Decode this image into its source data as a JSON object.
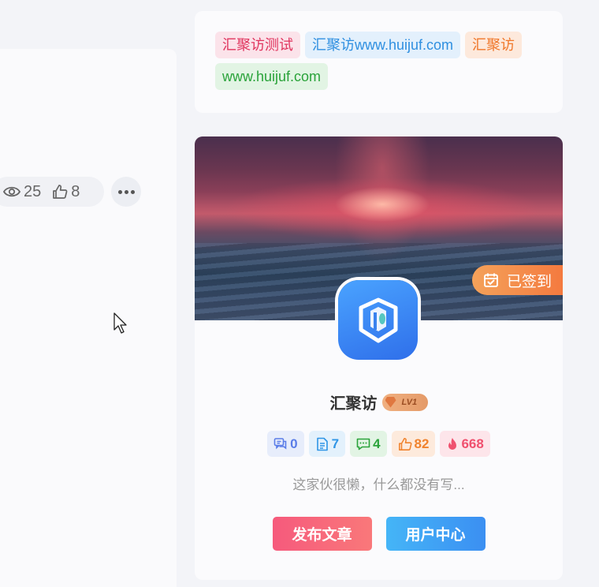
{
  "post_meta": {
    "views": "25",
    "likes": "8"
  },
  "tags": [
    {
      "label": "汇聚访测试",
      "color": "#e0355e",
      "bg": "#fbe3ea"
    },
    {
      "label": "汇聚访www.huijuf.com",
      "color": "#2f8fe0",
      "bg": "#e3f0fc"
    },
    {
      "label": "汇聚访",
      "color": "#f0772a",
      "bg": "#fde9dc"
    },
    {
      "label": "www.huijuf.com",
      "color": "#2aa33a",
      "bg": "#e2f4e4"
    }
  ],
  "user_card": {
    "checkin_label": "已签到",
    "username": "汇聚访",
    "level": "LV1",
    "stats": [
      {
        "icon": "comments-icon",
        "value": "0",
        "color": "#5a7de8",
        "bg": "#e7edfb"
      },
      {
        "icon": "document-icon",
        "value": "7",
        "color": "#2f95e6",
        "bg": "#e3f1fc"
      },
      {
        "icon": "message-icon",
        "value": "4",
        "color": "#2aa33a",
        "bg": "#e2f4e4"
      },
      {
        "icon": "thumbs-up-icon",
        "value": "82",
        "color": "#f0832e",
        "bg": "#fdeadc"
      },
      {
        "icon": "fire-icon",
        "value": "668",
        "color": "#f0506e",
        "bg": "#fde5ea"
      }
    ],
    "bio": "这家伙很懒，什么都没有写...",
    "post_button": "发布文章",
    "center_button": "用户中心"
  }
}
